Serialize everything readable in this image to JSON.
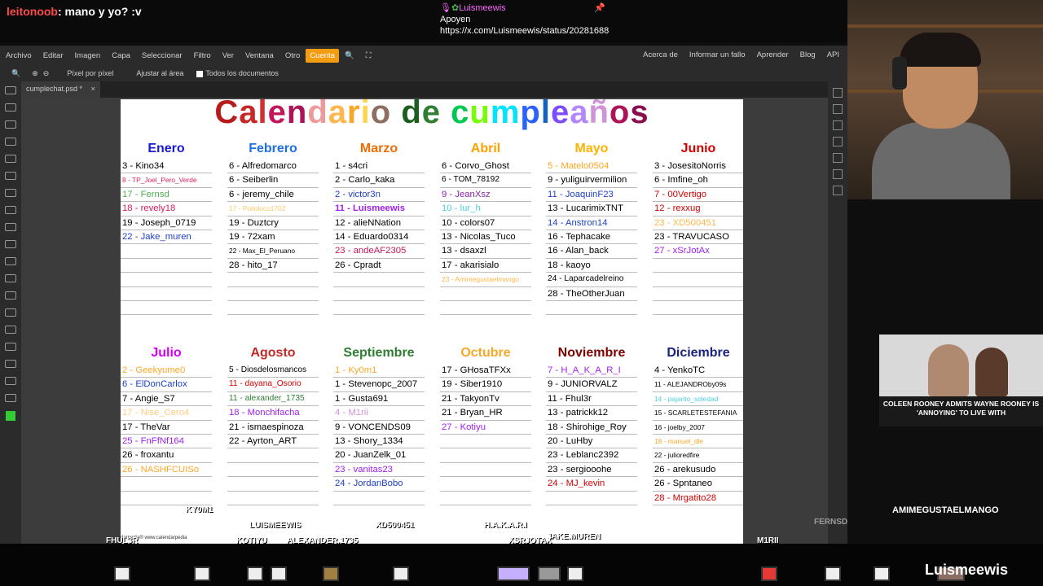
{
  "chat": {
    "top_user": "leitonoob",
    "top_message": ": mano y yo? :v",
    "mid_user": "Luismeewis",
    "mid_line1": "Apoyen",
    "mid_line2": "https://x.com/Luismeewis/status/20281688"
  },
  "menu": {
    "items": [
      "Archivo",
      "Editar",
      "Imagen",
      "Capa",
      "Seleccionar",
      "Filtro",
      "Ver",
      "Ventana",
      "Otro"
    ],
    "active": "Cuenta",
    "right": [
      "Acerca de",
      "Informar un fallo",
      "Aprender",
      "Blog",
      "API"
    ]
  },
  "tool_options": {
    "pixel": "Píxel por píxel",
    "fit": "Ajustar al área",
    "all_docs": "Todos los documentos"
  },
  "tab": {
    "name": "cumplechat.psd *",
    "close": "×"
  },
  "document": {
    "title_letters": [
      {
        "t": "C",
        "c": "#b71c1c"
      },
      {
        "t": "a",
        "c": "#c62828"
      },
      {
        "t": "l",
        "c": "#d32f2f"
      },
      {
        "t": "e",
        "c": "#c2185b"
      },
      {
        "t": "n",
        "c": "#ad1457"
      },
      {
        "t": "d",
        "c": "#ef9a9a"
      },
      {
        "t": "a",
        "c": "#ffb74d"
      },
      {
        "t": "r",
        "c": "#f9a825"
      },
      {
        "t": "i",
        "c": "#ffd54f"
      },
      {
        "t": "o",
        "c": "#8d6e63"
      },
      {
        "t": " ",
        "c": "#fff"
      },
      {
        "t": "d",
        "c": "#1b5e20"
      },
      {
        "t": "e",
        "c": "#2e7d32"
      },
      {
        "t": " ",
        "c": "#fff"
      },
      {
        "t": "c",
        "c": "#00c853"
      },
      {
        "t": "u",
        "c": "#76ff03"
      },
      {
        "t": "m",
        "c": "#00e5ff"
      },
      {
        "t": "p",
        "c": "#2962ff"
      },
      {
        "t": "l",
        "c": "#1565c0"
      },
      {
        "t": "e",
        "c": "#7c4dff"
      },
      {
        "t": "a",
        "c": "#b388ff"
      },
      {
        "t": "ñ",
        "c": "#ce93d8"
      },
      {
        "t": "o",
        "c": "#ad1457"
      },
      {
        "t": "s",
        "c": "#880e4f"
      }
    ],
    "footer": "darpedia®   www.calendarpedia",
    "months": [
      {
        "name": "Enero",
        "color": "#1a1ad0",
        "entries": [
          {
            "t": "3 - Kino34",
            "c": "#000"
          },
          {
            "t": "8 - TP_Joel_Pero_Verde",
            "c": "#e91e63",
            "sm": true
          },
          {
            "t": "17 - Fernsd",
            "c": "#4caf50"
          },
          {
            "t": "18 - revely18",
            "c": "#d81b60"
          },
          {
            "t": "19 - Joseph_0719",
            "c": "#000"
          },
          {
            "t": "22 - Jake_muren",
            "c": "#1e40c8"
          }
        ]
      },
      {
        "name": "Febrero",
        "color": "#1e6fe0",
        "entries": [
          {
            "t": "6 - Alfredomarco",
            "c": "#000"
          },
          {
            "t": "6 - Seiberlin",
            "c": "#000"
          },
          {
            "t": "6 - jeremy_chile",
            "c": "#000"
          },
          {
            "t": "17 - Polloloco1702",
            "c": "#f7c96b",
            "sm": true
          },
          {
            "t": "19 - Duztcry",
            "c": "#000"
          },
          {
            "t": "19 - 72xam",
            "c": "#000"
          },
          {
            "t": "22 - Max_El_Peruano",
            "c": "#000",
            "sm": true
          },
          {
            "t": "28 - hito_17",
            "c": "#000"
          }
        ]
      },
      {
        "name": "Marzo",
        "color": "#ef6c00",
        "entries": [
          {
            "t": "1 - s4cri",
            "c": "#000"
          },
          {
            "t": "2 - Carlo_kaka",
            "c": "#000"
          },
          {
            "t": "2 - victor3n",
            "c": "#1e40c8"
          },
          {
            "t": "11 - Luismeewis",
            "c": "#a020f0",
            "bold": true
          },
          {
            "t": "12 - alieNNation",
            "c": "#000"
          },
          {
            "t": "14 - Eduardo0314",
            "c": "#000"
          },
          {
            "t": "23 - andeAF2305",
            "c": "#c2185b"
          },
          {
            "t": "26 - Cpradt",
            "c": "#000"
          }
        ]
      },
      {
        "name": "Abril",
        "color": "#ffa000",
        "entries": [
          {
            "t": "6 - Corvo_Ghost",
            "c": "#000"
          },
          {
            "t": "6 - TOM_78192",
            "c": "#000",
            "sm2": true
          },
          {
            "t": "9 - JeanXsz",
            "c": "#8e24aa"
          },
          {
            "t": "10 - lur_h",
            "c": "#4dd0e1"
          },
          {
            "t": "10 - colors07",
            "c": "#000"
          },
          {
            "t": "13 - Nicolas_Tuco",
            "c": "#000"
          },
          {
            "t": "13 - dsaxzl",
            "c": "#000"
          },
          {
            "t": "17 - akarisialo",
            "c": "#000"
          },
          {
            "t": "23 - Amimegustaelmango",
            "c": "#ffb74d",
            "sm": true
          }
        ]
      },
      {
        "name": "Mayo",
        "color": "#ffb300",
        "entries": [
          {
            "t": "5 - Matelo0504",
            "c": "#ffa726"
          },
          {
            "t": "9 - yuliguirvermilion",
            "c": "#000"
          },
          {
            "t": "11 - JoaquinF23",
            "c": "#1e40c8"
          },
          {
            "t": "13 - LucarimixTNT",
            "c": "#000"
          },
          {
            "t": "14 - Anstron14",
            "c": "#1e40c8"
          },
          {
            "t": "16 - Tephacake",
            "c": "#000"
          },
          {
            "t": "16 - Alan_back",
            "c": "#000"
          },
          {
            "t": "18 - kaoyo",
            "c": "#000"
          },
          {
            "t": "24 - Laparcadelreino",
            "c": "#000",
            "sm2": true
          },
          {
            "t": "28 - TheOtherJuan",
            "c": "#000"
          }
        ]
      },
      {
        "name": "Junio",
        "color": "#d50000",
        "entries": [
          {
            "t": "3 - JosesitoNorris",
            "c": "#000"
          },
          {
            "t": "6 - Imfine_oh",
            "c": "#000"
          },
          {
            "t": "7 - 00Vertigo",
            "c": "#d50000"
          },
          {
            "t": "12 - rexxug",
            "c": "#d50000"
          },
          {
            "t": "23 - XD500451",
            "c": "#ffb74d"
          },
          {
            "t": "23 - TRAVUCASO",
            "c": "#000"
          },
          {
            "t": "27 - xSrJotAx",
            "c": "#a020f0"
          }
        ]
      },
      {
        "name": "Julio",
        "color": "#d500f9",
        "entries": [
          {
            "t": "2 - Geekyume0",
            "c": "#ffa726"
          },
          {
            "t": "6 - ElDonCarlox",
            "c": "#1e40c8"
          },
          {
            "t": "7 - Angie_S7",
            "c": "#000"
          },
          {
            "t": "17 - Nise_Cero4",
            "c": "#ffcc80"
          },
          {
            "t": "17 - TheVar",
            "c": "#000"
          },
          {
            "t": "25 - FnFfNf164",
            "c": "#a020f0"
          },
          {
            "t": "26 - froxantu",
            "c": "#000"
          },
          {
            "t": "26 - NASHFCUISo",
            "c": "#ffa726"
          }
        ]
      },
      {
        "name": "Agosto",
        "color": "#c62828",
        "entries": [
          {
            "t": "5 - Diosdelosmancos",
            "c": "#000",
            "sm2": true
          },
          {
            "t": "11 - dayana_Osorio",
            "c": "#d50000",
            "sm2": true
          },
          {
            "t": "11 - alexander_1735",
            "c": "#2e7d32",
            "sm2": true
          },
          {
            "t": "18 - Monchifacha",
            "c": "#a020f0"
          },
          {
            "t": "21 - ismaespinoza",
            "c": "#000"
          },
          {
            "t": "22 - Ayrton_ART",
            "c": "#000"
          }
        ]
      },
      {
        "name": "Septiembre",
        "color": "#2e7d32",
        "entries": [
          {
            "t": "1 - Ky0m1",
            "c": "#ffa726"
          },
          {
            "t": "1 - Stevenopc_2007",
            "c": "#000"
          },
          {
            "t": "1 - Gusta691",
            "c": "#000"
          },
          {
            "t": "4 - M1rii",
            "c": "#ce93d8"
          },
          {
            "t": "9 - VONCENDS09",
            "c": "#000"
          },
          {
            "t": "13 - Shory_1334",
            "c": "#000"
          },
          {
            "t": "20 - JuanZelk_01",
            "c": "#000"
          },
          {
            "t": "23 - vanitas23",
            "c": "#a020f0"
          },
          {
            "t": "24 - JordanBobo",
            "c": "#1e40c8"
          }
        ]
      },
      {
        "name": "Octubre",
        "color": "#f9a825",
        "entries": [
          {
            "t": "17 - GHosaTFXx",
            "c": "#000"
          },
          {
            "t": "19 - Siber1910",
            "c": "#000"
          },
          {
            "t": "21 - TakyonTv",
            "c": "#000"
          },
          {
            "t": "21 - Bryan_HR",
            "c": "#000"
          },
          {
            "t": "27 - Kotiyu",
            "c": "#a020f0"
          }
        ]
      },
      {
        "name": "Noviembre",
        "color": "#7f0000",
        "entries": [
          {
            "t": "7 - H_A_K_A_R_I",
            "c": "#a020f0"
          },
          {
            "t": "9 - JUNIORVALZ",
            "c": "#000"
          },
          {
            "t": "11 - Fhul3r",
            "c": "#000"
          },
          {
            "t": "13 - patrickk12",
            "c": "#000"
          },
          {
            "t": "18 - Shirohige_Roy",
            "c": "#000"
          },
          {
            "t": "20 - LuHby",
            "c": "#000"
          },
          {
            "t": "23 - Leblanc2392",
            "c": "#000"
          },
          {
            "t": "23 - sergiooohe",
            "c": "#000"
          },
          {
            "t": "24 - MJ_kevin",
            "c": "#d50000"
          }
        ]
      },
      {
        "name": "Diciembre",
        "color": "#1a237e",
        "entries": [
          {
            "t": "4 - YenkoTC",
            "c": "#000"
          },
          {
            "t": "11 - ALEJANDROby09s",
            "c": "#000",
            "sm": true
          },
          {
            "t": "14 - pajarito_soledad",
            "c": "#4dd0e1",
            "sm": true
          },
          {
            "t": "15 - SCARLETESTEFANIA",
            "c": "#000",
            "sm": true
          },
          {
            "t": "16 - joelby_2007",
            "c": "#000",
            "sm": true
          },
          {
            "t": "18 - manuel_dle",
            "c": "#ffa726",
            "sm": true
          },
          {
            "t": "22 - julioredfire",
            "c": "#000",
            "sm": true
          },
          {
            "t": "26 - arekusudo",
            "c": "#000"
          },
          {
            "t": "26 - Spntaneo",
            "c": "#000"
          },
          {
            "t": "28 - Mrgatito28",
            "c": "#d50000"
          }
        ]
      }
    ]
  },
  "overlay_nicks": [
    "KY0M1",
    "LUISMEEWIS",
    "XD500451",
    "H.A.K.A.R.I",
    "JAKE.MUREN",
    "FHUL3R",
    "KOTIYU",
    "ALEXANDER.1735",
    "XSRJOTAX",
    "M1RII",
    "FERNSD",
    "AMIMEGUSTAELMANGO"
  ],
  "news": {
    "headline": "COLEEN ROONEY ADMITS WAYNE ROONEY IS 'ANNOYING' TO LIVE WITH"
  },
  "watermark": "Luismeewis"
}
